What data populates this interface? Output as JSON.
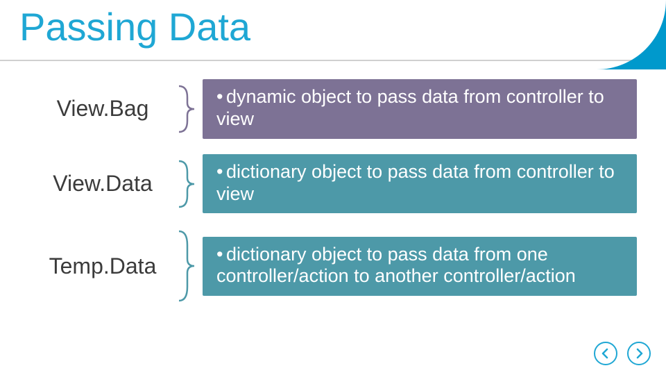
{
  "title": "Passing Data",
  "colors": {
    "title": "#1fa7d4",
    "row0": "#7d7295",
    "row1": "#4d99a8",
    "row2": "#4d99a8"
  },
  "rows": [
    {
      "label": "View.Bag",
      "desc": "dynamic object to pass data from controller to view"
    },
    {
      "label": "View.Data",
      "desc": "dictionary object to pass data from controller to view"
    },
    {
      "label": "Temp.Data",
      "desc": "dictionary object to pass data from one controller/action to another controller/action"
    }
  ],
  "nav": {
    "prev": "previous-slide",
    "next": "next-slide"
  }
}
